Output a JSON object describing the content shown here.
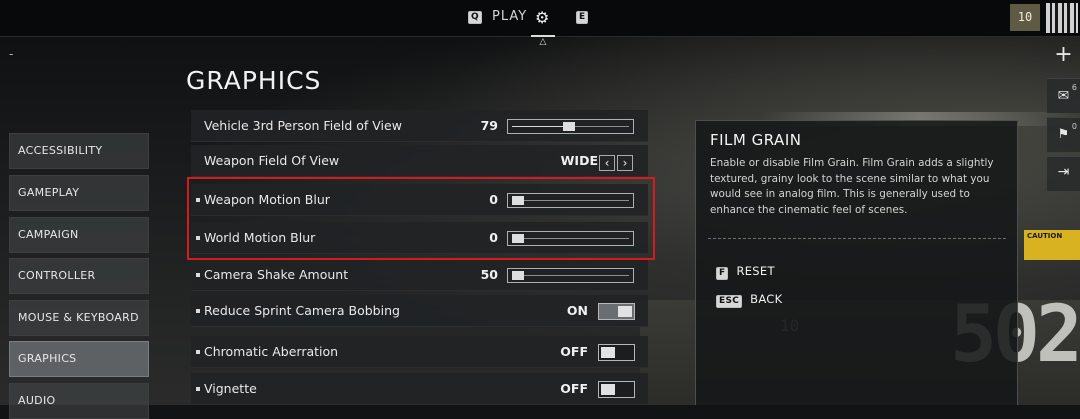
{
  "topbar": {
    "play_key": "Q",
    "play_label": "PLAY",
    "settings_icon": "gear-icon",
    "next_key": "E",
    "player_level": "10"
  },
  "header_dash": "-",
  "page_title": "GRAPHICS",
  "sidebar": {
    "items": [
      {
        "label": "ACCESSIBILITY"
      },
      {
        "label": "GAMEPLAY"
      },
      {
        "label": "CAMPAIGN"
      },
      {
        "label": "CONTROLLER"
      },
      {
        "label": "MOUSE & KEYBOARD"
      },
      {
        "label": "GRAPHICS",
        "active": true
      },
      {
        "label": "AUDIO"
      }
    ]
  },
  "settings": [
    {
      "label": "Vehicle 3rd Person Field of View",
      "control": "slider",
      "value": "79",
      "level": 0.49
    },
    {
      "label": "Weapon Field Of View",
      "control": "selector",
      "value": "WIDE"
    },
    {
      "label": "Weapon Motion Blur",
      "control": "slider",
      "value": "0",
      "level": 0,
      "bullet": true
    },
    {
      "label": "World Motion Blur",
      "control": "slider",
      "value": "0",
      "level": 0,
      "bullet": true
    },
    {
      "label": "Camera Shake Amount",
      "control": "slider",
      "value": "50",
      "level": 0,
      "bullet": true
    },
    {
      "label": "Reduce Sprint Camera Bobbing",
      "control": "toggle",
      "value": "ON",
      "bullet": true
    },
    {
      "label": "Chromatic Aberration",
      "control": "toggle",
      "value": "OFF",
      "bullet": true
    },
    {
      "label": "Vignette",
      "control": "toggle",
      "value": "OFF",
      "bullet": true
    }
  ],
  "info_panel": {
    "title": "FILM GRAIN",
    "description": "Enable or disable Film Grain. Film Grain adds a slightly textured, grainy look to the scene similar to what you would see in analog film. This is generally used to enhance the cinematic feel of scenes.",
    "reset_key": "F",
    "reset_label": "RESET",
    "back_key": "ESC",
    "back_label": "BACK"
  },
  "right_strip": {
    "plus_icon": "plus-icon",
    "mail_count": "6",
    "gift_count": "0"
  },
  "background": {
    "big_text": "502",
    "small_text": "10",
    "caution_text": "CAUTION"
  },
  "colors": {
    "highlight": "#d41c1c",
    "active_tab": "#5e6163",
    "row_bg": "#212325"
  }
}
